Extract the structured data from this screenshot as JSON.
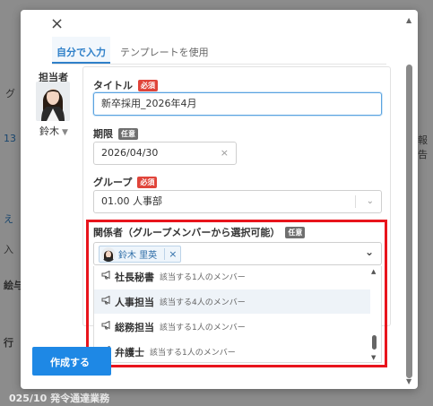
{
  "background": {
    "fragments": [
      "グ",
      "13",
      "え",
      "入",
      "絵与",
      "行",
      "報告"
    ],
    "footer_text": "025/10 発令通達業務"
  },
  "modal": {
    "tabs": [
      {
        "label": "自分で入力",
        "active": true
      },
      {
        "label": "テンプレートを使用",
        "active": false
      }
    ],
    "assignee": {
      "label": "担当者",
      "name": "鈴木",
      "avatar_icon": "person-photo-icon"
    },
    "fields": {
      "title": {
        "label": "タイトル",
        "badge": "必須",
        "value": "新卒採用_2026年4月"
      },
      "deadline": {
        "label": "期限",
        "badge": "任意",
        "value": "2026/04/30",
        "clear_icon": "×"
      },
      "group": {
        "label": "グループ",
        "badge": "必須",
        "value": "01.00 人事部"
      },
      "related": {
        "label": "関係者（グループメンバーから選択可能）",
        "badge": "任意",
        "selected": [
          {
            "name": "鈴木 里英",
            "remove": "×"
          }
        ]
      }
    },
    "dropdown": {
      "items": [
        {
          "name": "社長秘書",
          "count": "該当する1人のメンバー",
          "hover": false
        },
        {
          "name": "人事担当",
          "count": "該当する4人のメンバー",
          "hover": true
        },
        {
          "name": "総務担当",
          "count": "該当する1人のメンバー",
          "hover": false
        },
        {
          "name": "弁護士",
          "count": "該当する1人のメンバー",
          "hover": false
        }
      ],
      "item_icon": "megaphone-icon"
    },
    "create_button": {
      "label": "作成する"
    }
  },
  "colors": {
    "accent": "#1e88e5",
    "required_badge": "#e0443a",
    "optional_badge": "#6f6f6f",
    "highlight": "#e8141c"
  }
}
